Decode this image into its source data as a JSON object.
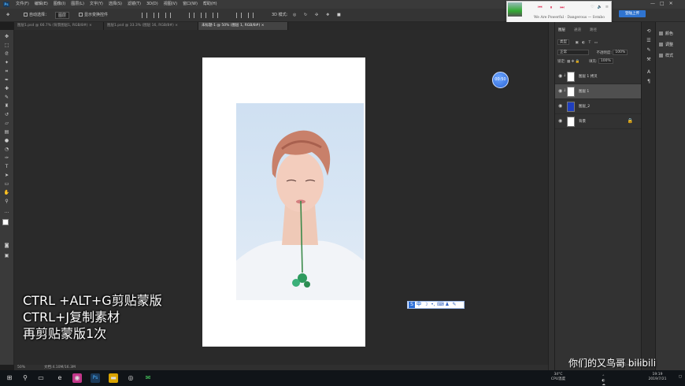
{
  "menubar": {
    "app_logo": "Ps",
    "items": [
      "文件(F)",
      "编辑(E)",
      "图像(I)",
      "图层(L)",
      "文字(Y)",
      "选择(S)",
      "滤镜(T)",
      "3D(D)",
      "视图(V)",
      "窗口(W)",
      "帮助(H)"
    ]
  },
  "options": {
    "auto_select_label": "自动选择：",
    "auto_select_value": "图层",
    "show_transform_label": "显示变换控件"
  },
  "tabs": [
    {
      "label": "图层1.psd @ 66.7% (背景图层1, RGB/8#) ×",
      "active": false
    },
    {
      "label": "图层1.psd @ 33.3% (图层 16, RGB/8#) ×",
      "active": false
    },
    {
      "label": "未标题-1 @ 50% (图层 1, RGB/8#) ×",
      "active": true
    }
  ],
  "tools": [
    "move-tool",
    "marquee-tool",
    "lasso-tool",
    "magic-wand-tool",
    "crop-tool",
    "eyedropper-tool",
    "healing-brush-tool",
    "brush-tool",
    "clone-stamp-tool",
    "history-brush-tool",
    "eraser-tool",
    "gradient-tool",
    "blur-tool",
    "dodge-tool",
    "pen-tool",
    "type-tool",
    "path-selection-tool",
    "shape-tool",
    "hand-tool",
    "zoom-tool",
    "more-tools",
    "color-swatches",
    "quick-mask",
    "screen-mode"
  ],
  "canvas": {
    "stopwatch_text": "00:50",
    "caption_lines": [
      "CTRL +ALT+G剪贴蒙版",
      "CTRL+J复制素材",
      "再剪贴蒙版1次"
    ]
  },
  "ime_toolbar": [
    "S",
    "中",
    "☽",
    "•,",
    "⌨",
    "♟",
    "✎"
  ],
  "statusbar": {
    "zoom": "50%",
    "doc_info": "文档:4.10M/16.3M"
  },
  "layers_panel": {
    "tabs": [
      {
        "label": "图层",
        "active": true
      },
      {
        "label": "通道",
        "active": false
      },
      {
        "label": "路径",
        "active": false
      }
    ],
    "filter_label": "类型",
    "blend_mode": "正常",
    "opacity_label": "不透明度:",
    "opacity_value": "100%",
    "lock_label": "锁定:",
    "fill_label": "填充:",
    "fill_value": "100%",
    "layers": [
      {
        "name": "图层 1 拷贝",
        "clipped": true,
        "selected": false,
        "thumb": "#ffffff"
      },
      {
        "name": "图层 1",
        "clipped": true,
        "selected": true,
        "thumb": "#ffffff"
      },
      {
        "name": "图层_2",
        "clipped": false,
        "selected": false,
        "thumb": "#1f3fbf"
      },
      {
        "name": "背景",
        "clipped": false,
        "selected": false,
        "thumb": "#ffffff",
        "locked": true
      }
    ]
  },
  "side_panels": [
    {
      "label": "颜色",
      "icon": "color-icon"
    },
    {
      "label": "调整",
      "icon": "adjust-icon"
    },
    {
      "label": "样式",
      "icon": "style-icon"
    }
  ],
  "music_player": {
    "song": "We Are Powerful · Dangerous — Svmbo",
    "controls": [
      "⏮",
      "⏸",
      "⏭"
    ]
  },
  "login_button": "登陆上传",
  "taskbar": {
    "temperature": "34°C",
    "cpu_label": "CPU温度",
    "time": "19:19",
    "date": "2019/7/21"
  },
  "watermark": "你们的又鸟哥 bilibili"
}
